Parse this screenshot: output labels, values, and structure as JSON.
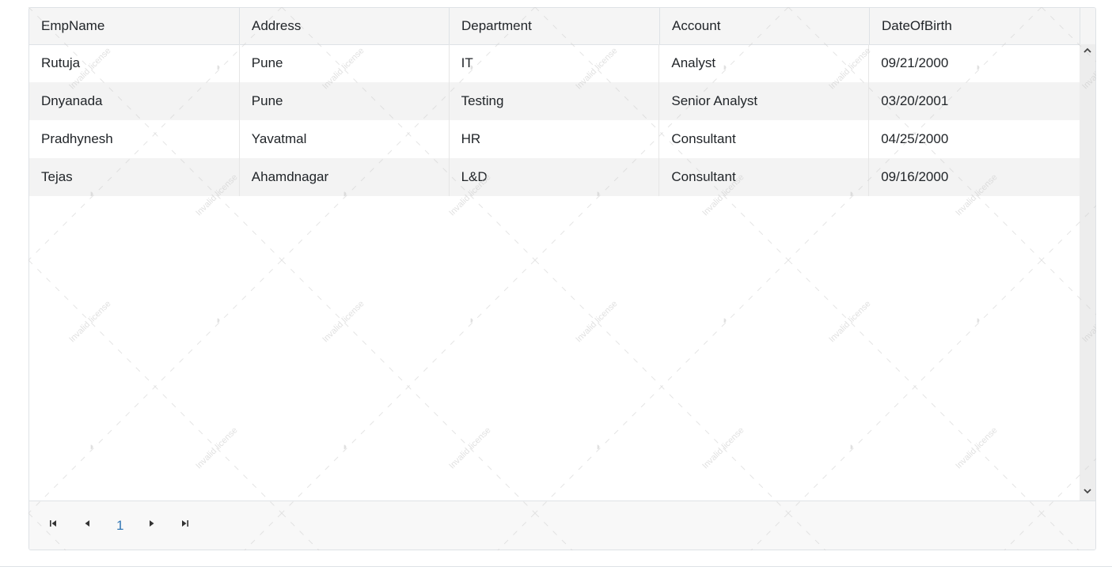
{
  "columns": [
    "EmpName",
    "Address",
    "Department",
    "Account",
    "DateOfBirth"
  ],
  "rows": [
    [
      "Rutuja",
      "Pune",
      "IT",
      "Analyst",
      "09/21/2000"
    ],
    [
      "Dnyanada",
      "Pune",
      "Testing",
      "Senior Analyst",
      "03/20/2001"
    ],
    [
      "Pradhynesh",
      "Yavatmal",
      "HR",
      "Consultant",
      "04/25/2000"
    ],
    [
      "Tejas",
      "Ahamdnagar",
      "L&D",
      "Consultant",
      "09/16/2000"
    ]
  ],
  "pager": {
    "current_page": "1",
    "first_icon": "first-page-icon",
    "prev_icon": "previous-page-icon",
    "next_icon": "next-page-icon",
    "last_icon": "last-page-icon"
  },
  "scrollbar": {
    "up_icon": "chevron-up-icon",
    "down_icon": "chevron-down-icon"
  },
  "watermark": {
    "text": "Invalid license"
  },
  "colors": {
    "header_bg": "#f5f5f5",
    "alt_row_bg": "#f3f3f3",
    "page_link": "#3277b5"
  }
}
